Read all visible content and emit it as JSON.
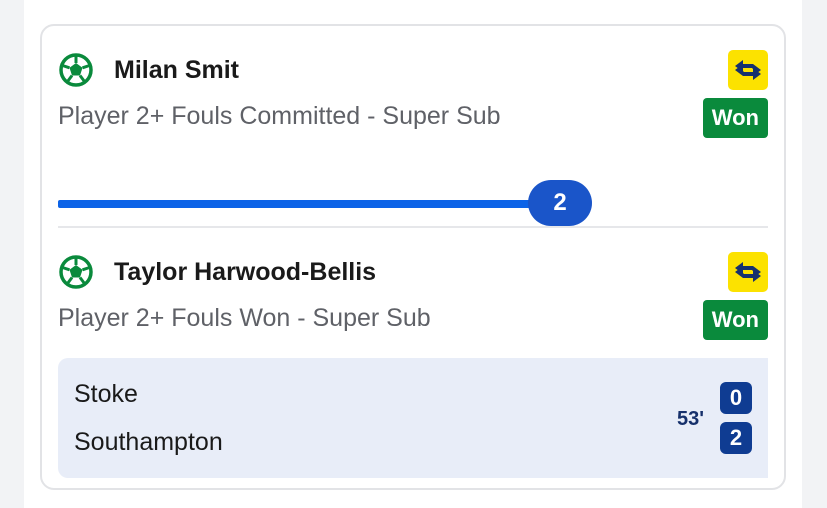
{
  "legs": [
    {
      "player": "Milan Smit",
      "market": "Player 2+ Fouls Committed - Super Sub",
      "status": "Won",
      "progress": {
        "value": "2",
        "fraction": 1.0
      }
    },
    {
      "player": "Taylor Harwood-Bellis",
      "market": "Player 2+ Fouls Won - Super Sub",
      "status": "Won",
      "match": {
        "home_team": "Stoke",
        "away_team": "Southampton",
        "time": "53'",
        "home_score": "0",
        "away_score": "2"
      }
    }
  ],
  "icons": {
    "sport": "football-icon",
    "super_sub": "swap-arrows-icon"
  },
  "colors": {
    "won": "#0a8a3c",
    "super_sub": "#fce200",
    "progress": "#0c63e7",
    "score": "#0f3c92"
  }
}
